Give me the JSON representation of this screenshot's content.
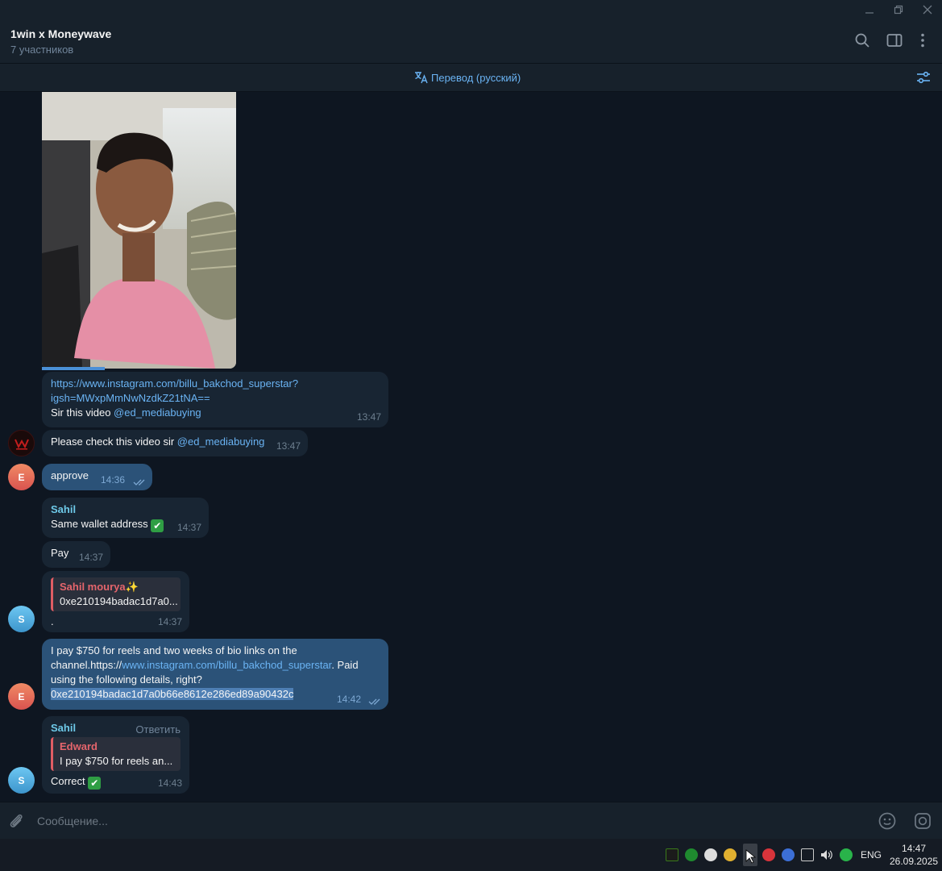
{
  "window": {
    "minimize_icon": "minimize-icon",
    "restore_icon": "restore-icon",
    "close_icon": "close-icon"
  },
  "header": {
    "title": "1win x Moneywave",
    "subtitle": "7 участников"
  },
  "translate_bar": {
    "label": "Перевод (русский)"
  },
  "messages": {
    "m1": {
      "link_line1": "https://www.instagram.com/billu_bakchod_superstar?",
      "link_line2": "igsh=MWxpMmNwNzdkZ21tNA==",
      "text_prefix": "Sir this video ",
      "mention": "@ed_mediabuying",
      "time": "13:47"
    },
    "m2": {
      "text_prefix": "Please check this video sir ",
      "mention": "@ed_mediabuying",
      "time": "13:47"
    },
    "m3": {
      "avatar_letter": "E",
      "text": "approve",
      "time": "14:36"
    },
    "m4": {
      "sender": "Sahil",
      "text": "Same wallet address",
      "emoji": "✔",
      "time": "14:37"
    },
    "m5": {
      "text": "Pay",
      "time": "14:37"
    },
    "m6": {
      "avatar_letter": "S",
      "reply_name": "Sahil mourya✨",
      "reply_text": "0xe210194badac1d7a0...",
      "text": ".",
      "time": "14:37"
    },
    "m7": {
      "avatar_letter": "E",
      "line1": "I pay $750 for reels and two weeks of bio links on the",
      "line2_prefix": "channel.https://",
      "line2_link": "www.instagram.com/billu_bakchod_superstar",
      "line2_suffix": ". Paid",
      "line3": "using the following details, right?",
      "line4": "0xe210194badac1d7a0b66e8612e286ed89a90432c",
      "time": "14:42"
    },
    "m8": {
      "avatar_letter": "S",
      "sender": "Sahil",
      "reply_button": "Ответить",
      "reply_name": "Edward",
      "reply_text": "I pay $750 for reels an...",
      "text": "Correct",
      "emoji": "✔",
      "time": "14:43"
    }
  },
  "composer": {
    "placeholder": "Сообщение..."
  },
  "taskbar": {
    "lang": "ENG",
    "time": "14:47",
    "date": "26.09.2025"
  },
  "colors": {
    "background": "#0e1621",
    "panel": "#17212b",
    "incoming_bubble": "#182533",
    "outgoing_bubble": "#2b5278",
    "accent": "#6ab3f3"
  }
}
